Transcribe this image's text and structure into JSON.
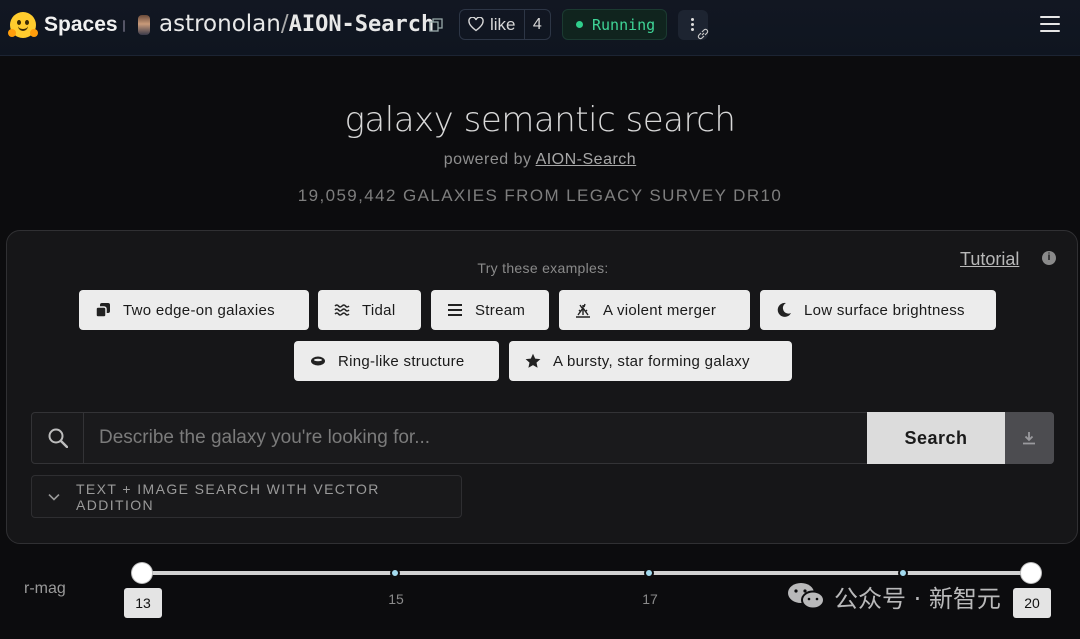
{
  "header": {
    "spaces_label": "Spaces",
    "owner": "astronolan",
    "slash": "/",
    "repo": "AION-Search",
    "like_label": "like",
    "like_count": "4",
    "status": "Running",
    "icons": [
      "hf-logo-icon",
      "copy-icon",
      "heart-icon",
      "more-icon",
      "link-icon",
      "menu-icon"
    ]
  },
  "hero": {
    "title": "galaxy semantic search",
    "powered_prefix": "powered by ",
    "powered_link": "AION-Search",
    "count": "19,059,442 GALAXIES FROM LEGACY SURVEY DR10"
  },
  "panel": {
    "tutorial": "Tutorial",
    "try_label": "Try these examples:",
    "examples": [
      {
        "label": "Two edge-on galaxies",
        "icon": "layers-icon"
      },
      {
        "label": "Tidal",
        "icon": "waves-icon"
      },
      {
        "label": "Stream",
        "icon": "lines-icon"
      },
      {
        "label": "A violent merger",
        "icon": "explosion-icon"
      },
      {
        "label": "Low surface brightness",
        "icon": "moon-icon"
      },
      {
        "label": "Ring-like structure",
        "icon": "ring-icon"
      },
      {
        "label": "A bursty, star forming galaxy",
        "icon": "star-icon"
      }
    ],
    "search_placeholder": "Describe the galaxy you're looking for...",
    "search_value": "",
    "search_button": "Search",
    "vector_toggle": "TEXT + IMAGE SEARCH WITH VECTOR ADDITION"
  },
  "slider": {
    "label": "r-mag",
    "min_value": "13",
    "max_value": "20",
    "ticks": [
      "15",
      "17"
    ]
  },
  "watermark": {
    "text": "公众号 · 新智元"
  }
}
